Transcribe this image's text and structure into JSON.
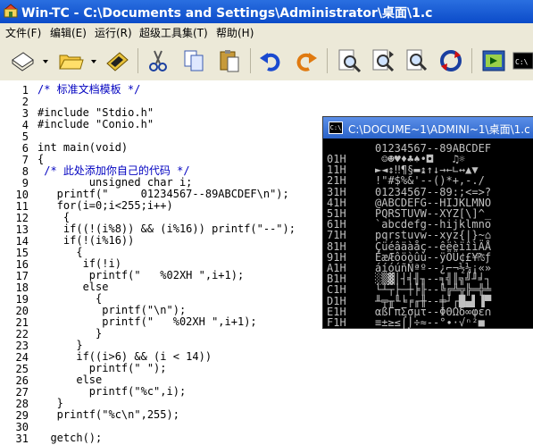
{
  "window": {
    "title": "Win-TC - C:\\Documents and Settings\\Administrator\\桌面\\1.c"
  },
  "menu": [
    "文件(F)",
    "编辑(E)",
    "运行(R)",
    "超级工具集(T)",
    "帮助(H)"
  ],
  "toolbar": {
    "icons": [
      "new-file-icon",
      "open-folder-icon",
      "save-disk-icon",
      "cut-scissors-icon",
      "copy-icon",
      "paste-icon",
      "undo-icon",
      "redo-icon",
      "find-icon",
      "find-next-icon",
      "replace-icon",
      "refresh-icon",
      "compile-run-icon",
      "console-icon"
    ]
  },
  "editor": {
    "line_numbers": [
      "1",
      "2",
      "3",
      "4",
      "5",
      "6",
      "7",
      "8",
      "9",
      "10",
      "11",
      "12",
      "13",
      "14",
      "15",
      "16",
      "17",
      "18",
      "19",
      "20",
      "21",
      "22",
      "23",
      "24",
      "25",
      "26",
      "27",
      "28",
      "29",
      "30",
      "31"
    ],
    "lines": [
      "/* 标准文档模板 */",
      "",
      "#include \"Stdio.h\"",
      "#include \"Conio.h\"",
      "",
      "int main(void)",
      "{",
      " /* 此处添加你自己的代码 */",
      "        unsigned char i;",
      "   printf(\"     01234567--89ABCDEF\\n\");",
      "   for(i=0;i<255;i++)",
      "    {",
      "    if((!(i%8)) && (i%16)) printf(\"--\");",
      "    if(!(i%16))",
      "      {",
      "       if(!i)",
      "        printf(\"   %02XH \",i+1);",
      "       else",
      "         {",
      "          printf(\"\\n\");",
      "          printf(\"   %02XH \",i+1);",
      "         }",
      "      }",
      "      if((i>6) && (i < 14))",
      "        printf(\" \");",
      "      else",
      "        printf(\"%c\",i);",
      "   }",
      "   printf(\"%c\\n\",255);",
      "",
      "  getch();"
    ]
  },
  "console": {
    "title": "C:\\DOCUME~1\\ADMINI~1\\桌面\\1.c",
    "header": "01234567--89ABCDEF",
    "rows": [
      {
        "label": "01H",
        "text": " ☺☻♥♦♣♠•◘   ♫☼"
      },
      {
        "label": "11H",
        "text": "►◄↕‼¶§▬↨↑↓→←∟↔▲▼"
      },
      {
        "label": "21H",
        "text": "!\"#$%&'--()*+,-./"
      },
      {
        "label": "31H",
        "text": "01234567--89:;<=>?"
      },
      {
        "label": "41H",
        "text": "@ABCDEFG--HIJKLMNO"
      },
      {
        "label": "51H",
        "text": "PQRSTUVW--XYZ[\\]^_"
      },
      {
        "label": "61H",
        "text": "`abcdefg--hijklmno"
      },
      {
        "label": "71H",
        "text": "pqrstuvw--xyz{|}~⌂"
      },
      {
        "label": "81H",
        "text": "Çüéâäàåç--êëèïîìÄÅ"
      },
      {
        "label": "91H",
        "text": "ÉæÆôöòûù--ÿÖÜ¢£¥₧ƒ"
      },
      {
        "label": "A1H",
        "text": "áíóúñÑªº--¿⌐¬½¼¡«»"
      },
      {
        "label": "B1H",
        "text": "░▒▓│┤╡╢╖--╕╣║╗╝╜╛┐"
      },
      {
        "label": "C1H",
        "text": "└┴┬├─┼╞╟--╚╔╩╦╠═╬╧"
      },
      {
        "label": "D1H",
        "text": "╨╤╥╙╘╒╓╫--╪┘┌█▄▌▐▀"
      },
      {
        "label": "E1H",
        "text": "αßΓπΣσµτ--ΦΘΩδ∞φε∩"
      },
      {
        "label": "F1H",
        "text": "≡±≥≤⌠⌡÷≈--°∙·√ⁿ²■"
      }
    ]
  },
  "colors": {
    "titlebar": "#0b4bc9",
    "menubar": "#ece9d8",
    "console_bg": "#000000"
  }
}
